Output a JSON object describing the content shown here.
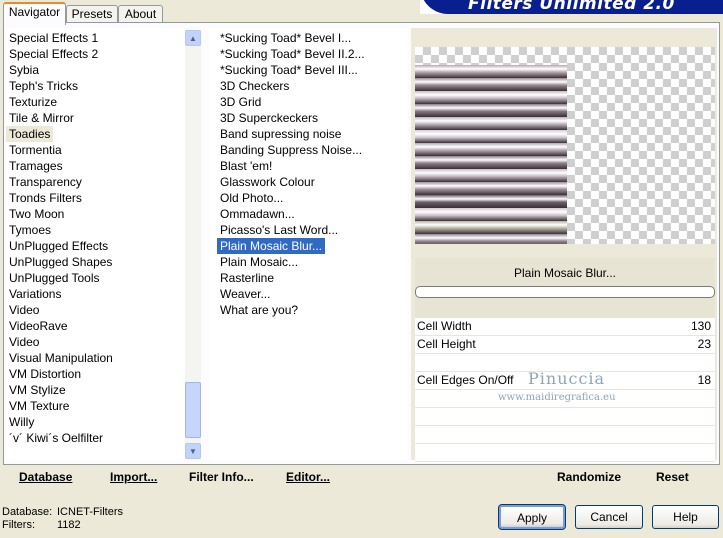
{
  "tabs": [
    {
      "label": "Navigator",
      "active": true
    },
    {
      "label": "Presets",
      "active": false
    },
    {
      "label": "About",
      "active": false
    }
  ],
  "banner": {
    "title": "Filters Unlimited 2.0"
  },
  "categories": [
    "Special Effects 1",
    "Special Effects 2",
    "Sybia",
    "Teph's Tricks",
    "Texturize",
    "Tile & Mirror",
    "Toadies",
    "Tormentia",
    "Tramages",
    "Transparency",
    "Tronds Filters",
    "Two Moon",
    "Tymoes",
    "UnPlugged Effects",
    "UnPlugged Shapes",
    "UnPlugged Tools",
    "Variations",
    "Video",
    "VideoRave",
    "Video",
    "Visual Manipulation",
    "VM Distortion",
    "VM Stylize",
    "VM Texture",
    "Willy",
    "´v´ Kiwi´s Oelfilter"
  ],
  "selected_category_index": 6,
  "filters": [
    "*Sucking Toad*  Bevel I...",
    "*Sucking Toad*  Bevel II.2...",
    "*Sucking Toad*  Bevel III...",
    "3D Checkers",
    "3D Grid",
    "3D Superckeckers",
    "Band supressing noise",
    "Banding Suppress Noise...",
    "Blast 'em!",
    "Glasswork Colour",
    "Old Photo...",
    "Ommadawn...",
    "Picasso's Last Word...",
    "Plain Mosaic Blur...",
    "Plain Mosaic...",
    "Rasterline",
    "Weaver...",
    "What are you?"
  ],
  "selected_filter_index": 13,
  "preview": {
    "stripe_colors": [
      "#b7a6ad",
      "#9a8891",
      "#c8bcc4",
      "#8b7a84",
      "#bdb3bd",
      "#d4ccd6",
      "#b5a9b3",
      "#8e7f89",
      "#c7bcc4",
      "#a3939c",
      "#6d5f68",
      "#d2c8cf",
      "#b8b6a4",
      "#928491"
    ]
  },
  "current_filter": "Plain Mosaic Blur...",
  "progress": 0.0,
  "params": [
    {
      "label": "Cell Width",
      "value": "130"
    },
    {
      "label": "Cell Height",
      "value": "23"
    },
    {
      "label": "",
      "value": ""
    },
    {
      "label": "Cell Edges On/Off",
      "value": "18"
    },
    {
      "label": "",
      "value": ""
    },
    {
      "label": "",
      "value": ""
    },
    {
      "label": "",
      "value": ""
    },
    {
      "label": "",
      "value": ""
    }
  ],
  "watermark": {
    "name": "Pinuccia",
    "site": "www.maidiregrafica.eu"
  },
  "bottom_buttons": {
    "database": "Database",
    "import": "Import...",
    "filter_info": "Filter Info...",
    "editor": "Editor...",
    "randomize": "Randomize",
    "reset": "Reset"
  },
  "status": {
    "database_label": "Database:",
    "database_value": "ICNET-Filters",
    "filters_label": "Filters:",
    "filters_value": "1182"
  },
  "dialog_buttons": {
    "apply": "Apply",
    "cancel": "Cancel",
    "help": "Help"
  }
}
